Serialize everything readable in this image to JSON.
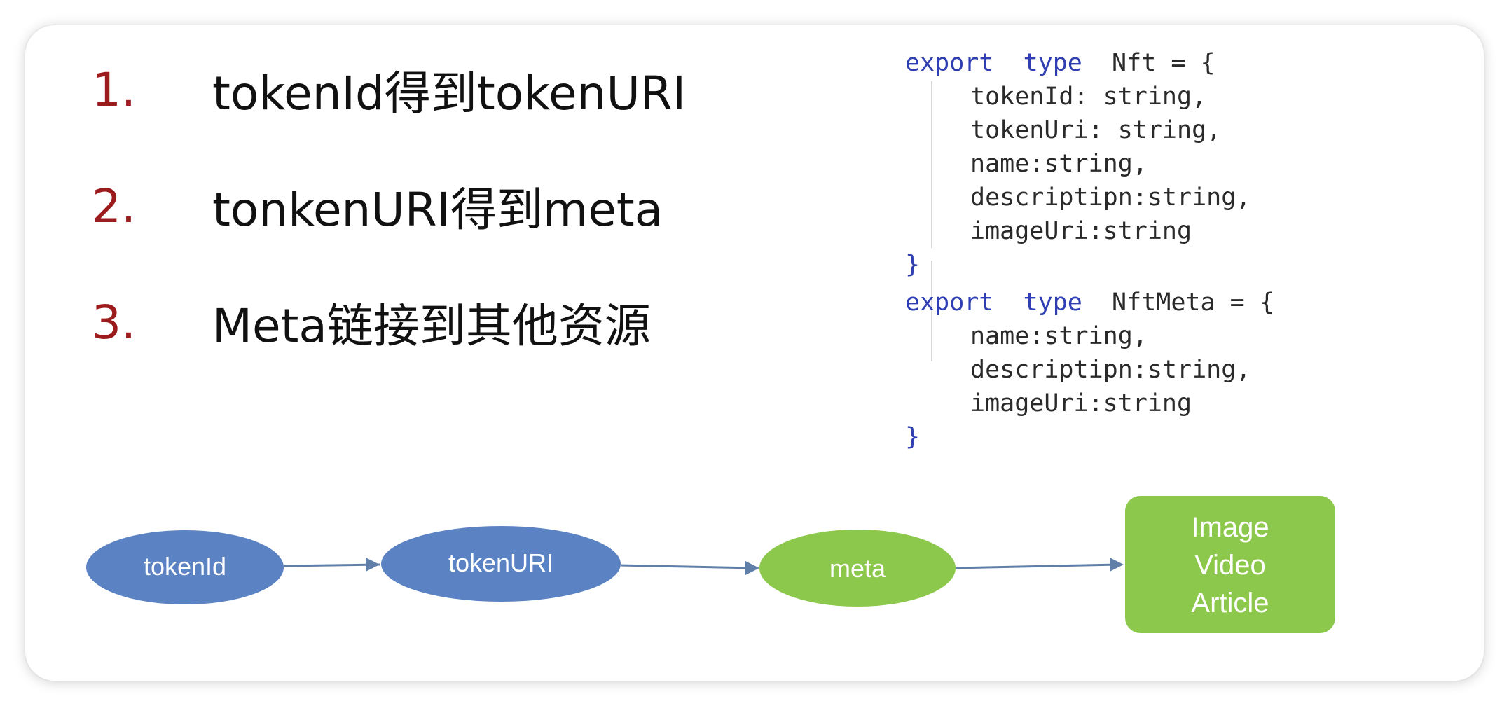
{
  "steps": [
    {
      "number": "1.",
      "text": "tokenId得到tokenURI"
    },
    {
      "number": "2.",
      "text": "tonkenURI得到meta"
    },
    {
      "number": "3.",
      "text": "Meta链接到其他资源"
    }
  ],
  "code": {
    "block1": {
      "keyword_export": "export",
      "keyword_type": "type",
      "name_line": "Nft = {",
      "fields": [
        "tokenId: string,",
        "tokenUri: string,",
        "name:string,",
        "descriptipn:string,",
        "imageUri:string"
      ],
      "close": "}"
    },
    "block2": {
      "keyword_export": "export",
      "keyword_type": "type",
      "name_line": "NftMeta = {",
      "fields": [
        "name:string,",
        "descriptipn:string,",
        "imageUri:string"
      ],
      "close": "}"
    }
  },
  "flow": {
    "nodes": {
      "tokenid": "tokenId",
      "tokenuri": "tokenURI",
      "meta": "meta",
      "resources": [
        "Image",
        "Video",
        "Article"
      ]
    },
    "colors": {
      "blue_node": "#5b82c3",
      "green_node": "#8cc84b",
      "arrow": "#5f7fa8",
      "step_number": "#9c1c1e",
      "keyword": "#2f3fb3"
    }
  }
}
